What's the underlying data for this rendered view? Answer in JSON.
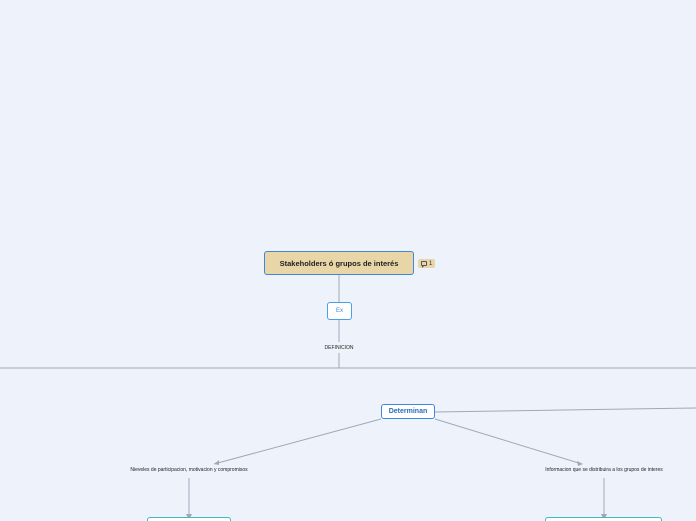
{
  "mindmap": {
    "root": {
      "label": "Stakeholders ó grupos de interés",
      "comment_count": "1",
      "comment_icon": "comment-icon"
    },
    "ex_node": {
      "label": "Ex"
    },
    "definicion": {
      "label": "DEFINICION"
    },
    "determinan": {
      "label": "Determinan"
    },
    "branch_left": {
      "label": "Nieveles de participacion, motivacion y compromisos"
    },
    "branch_right": {
      "label": "Informacion que se distribuira a los grupos de interes"
    }
  },
  "colors": {
    "background": "#eef2fb",
    "root_fill": "#e9d6a8",
    "node_border": "#3f88d8",
    "connector": "#a0a8b8",
    "partial_border": "#3fb8c8"
  }
}
